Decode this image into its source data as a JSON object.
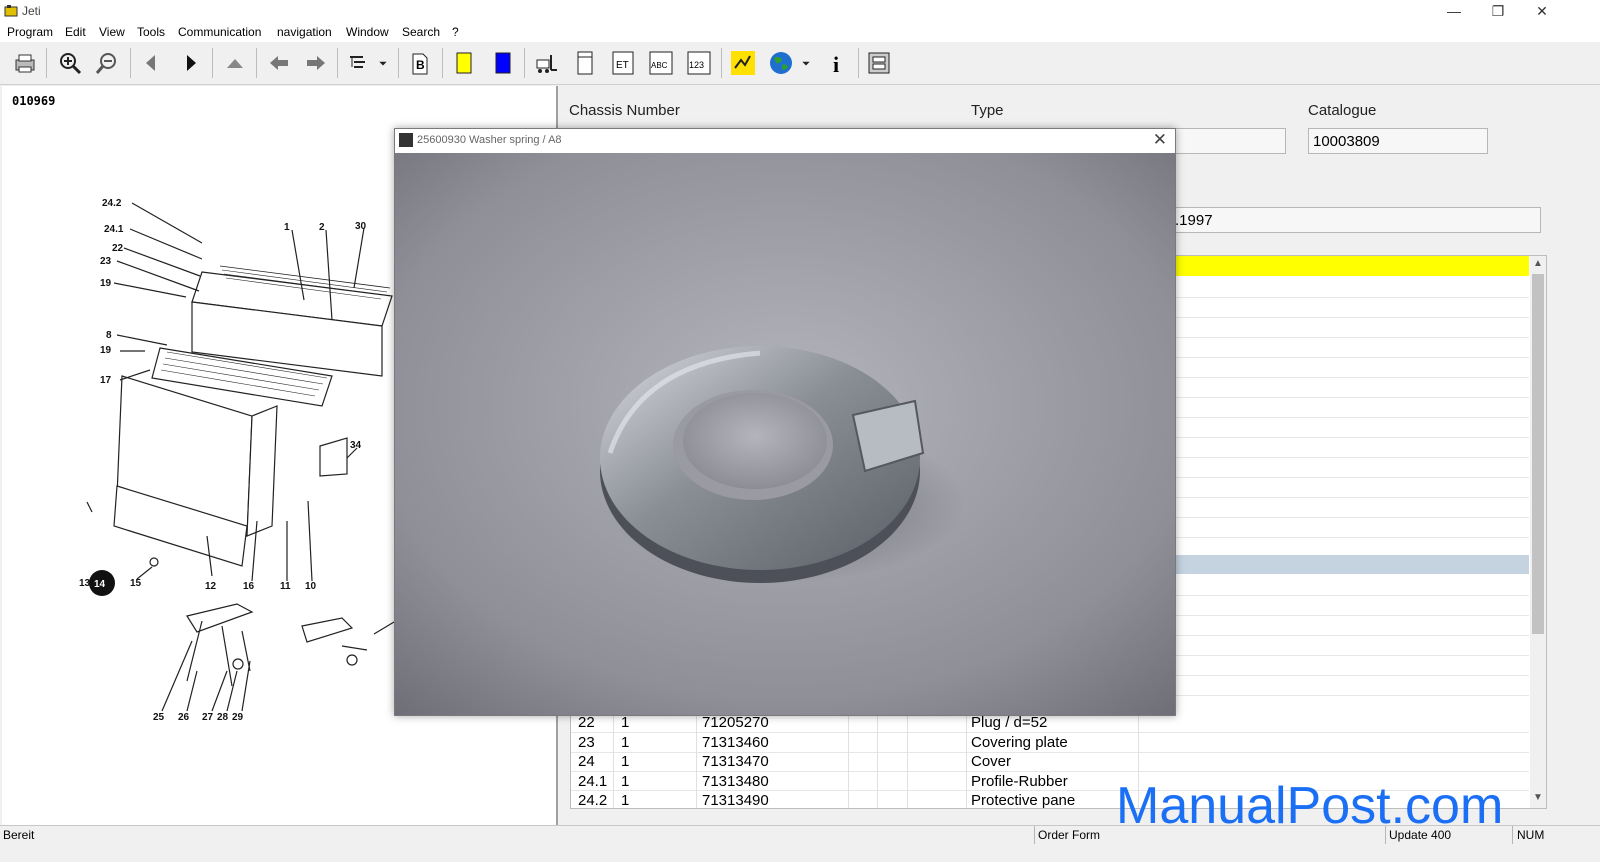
{
  "window": {
    "title": "Jeti",
    "minimize": "—",
    "restore": "❐",
    "close": "✕"
  },
  "menu": [
    "Program",
    "Edit",
    "View",
    "Tools",
    "Communication",
    "navigation",
    "Window",
    "Search",
    "?"
  ],
  "toolbar": {
    "icons": [
      "print-icon",
      "zoom-in-icon",
      "zoom-out-icon",
      "previous-icon",
      "next-icon",
      "up-icon",
      "back-icon",
      "forward-icon",
      "tree-view-icon",
      "b-bookmark-icon",
      "yellow-marker-icon",
      "blue-marker-icon",
      "forklift-icon",
      "document-icon",
      "et-icon",
      "abc-icon",
      "123-icon",
      "assembly-icon",
      "globe-icon",
      "info-icon",
      "archive-icon"
    ],
    "et_label": "ET",
    "abc_label": "ABC",
    "num_label": "123",
    "b_label": "B",
    "info_label": "i"
  },
  "diagram": {
    "id": "010969",
    "callouts": [
      "24.2",
      "24.1",
      "22",
      "23",
      "19",
      "1",
      "2",
      "30",
      "8",
      "19",
      "17",
      "34",
      "13",
      "14",
      "15",
      "12",
      "16",
      "11",
      "10",
      "25",
      "26",
      "27",
      "28",
      "29"
    ],
    "highlighted_callout": "14"
  },
  "header": {
    "chassis_label": "Chassis Number",
    "type_label": "Type",
    "catalogue_label": "Catalogue",
    "catalogue_value": "10003809",
    "date_partial": ".1997"
  },
  "parts_table": {
    "rows": [
      {
        "pos": "22",
        "qty": "1",
        "part_no": "71205270",
        "description": "Plug / d=52"
      },
      {
        "pos": "23",
        "qty": "1",
        "part_no": "71313460",
        "description": "Covering plate"
      },
      {
        "pos": "24",
        "qty": "1",
        "part_no": "71313470",
        "description": "Cover"
      },
      {
        "pos": "24.1",
        "qty": "1",
        "part_no": "71313480",
        "description": "Profile-Rubber"
      },
      {
        "pos": "24.2",
        "qty": "1",
        "part_no": "71313490",
        "description": "Protective pane"
      }
    ]
  },
  "dialog": {
    "title": "25600930 Washer spring / A8",
    "close": "✕"
  },
  "status": {
    "left": "Bereit",
    "order": "Order Form",
    "update": "Update 400",
    "num": "NUM"
  },
  "watermark": "ManualPost.com",
  "colors": {
    "highlight_row": "#ffff00",
    "selected_row": "#c5d3e0",
    "watermark": "#1a6ff5"
  }
}
